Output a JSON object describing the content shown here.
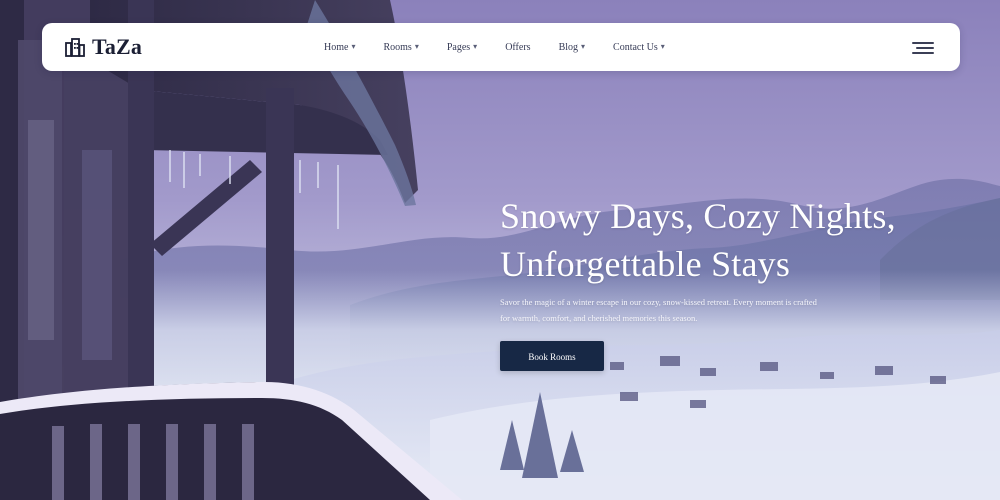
{
  "brand": {
    "name": "TaZa",
    "logo_icon": "building-icon"
  },
  "nav": {
    "items": [
      {
        "label": "Home",
        "has_dropdown": true
      },
      {
        "label": "Rooms",
        "has_dropdown": true
      },
      {
        "label": "Pages",
        "has_dropdown": true
      },
      {
        "label": "Offers",
        "has_dropdown": false
      },
      {
        "label": "Blog",
        "has_dropdown": true
      },
      {
        "label": "Contact Us",
        "has_dropdown": true
      }
    ],
    "caret": "▾",
    "menu_icon": "hamburger-menu-icon"
  },
  "hero": {
    "title_line_1": "Snowy Days, Cozy Nights,",
    "title_line_2": "Unforgettable Stays",
    "description_line_1": "Savor the magic of a winter escape in our cozy, snow-kissed retreat. Every moment is crafted",
    "description_line_2": "for warmth, comfort, and cherished memories this season.",
    "button_label": "Book Rooms"
  },
  "colors": {
    "navbar_bg": "#ffffff",
    "button_bg": "#172845",
    "hero_text": "#ffffff"
  }
}
